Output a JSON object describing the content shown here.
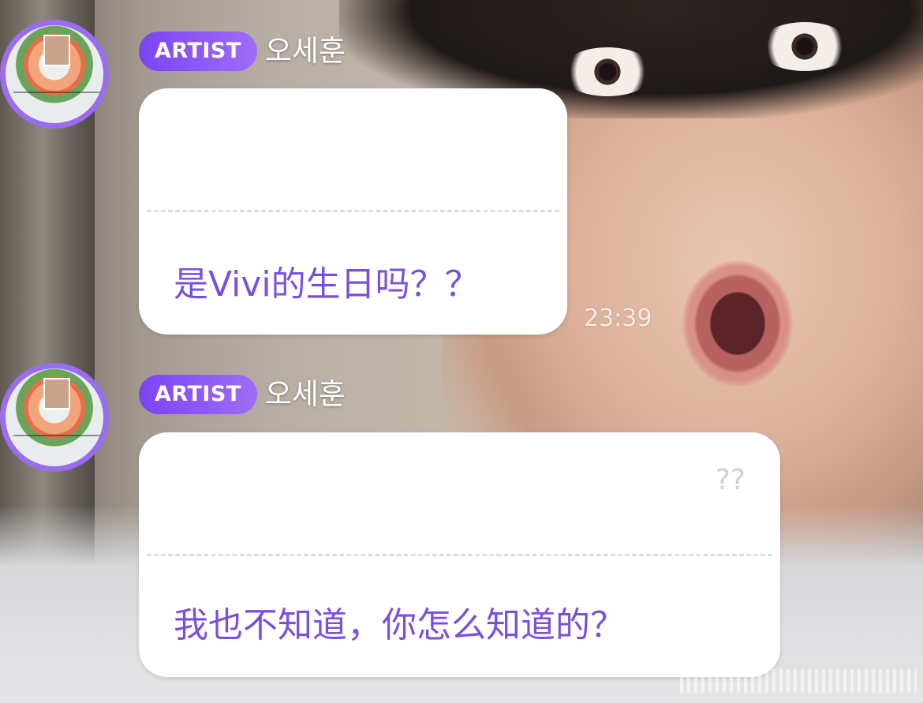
{
  "messages": [
    {
      "badge": "ARTIST",
      "author": "오세훈",
      "quoted_text": "",
      "reply_text": "是Vivi的生日吗？？",
      "time": "23:39"
    },
    {
      "badge": "ARTIST",
      "author": "오세훈",
      "quoted_text": "??",
      "reply_text": "我也不知道，你怎么知道的？"
    }
  ],
  "colors": {
    "badge_gradient_start": "#7b44f2",
    "badge_gradient_end": "#a06cf6",
    "reply_text": "#7a4fe0",
    "avatar_ring": "#9a6cf0",
    "bubble": "#ffffff"
  },
  "icons": [
    "avatar-flower-bouquet"
  ]
}
